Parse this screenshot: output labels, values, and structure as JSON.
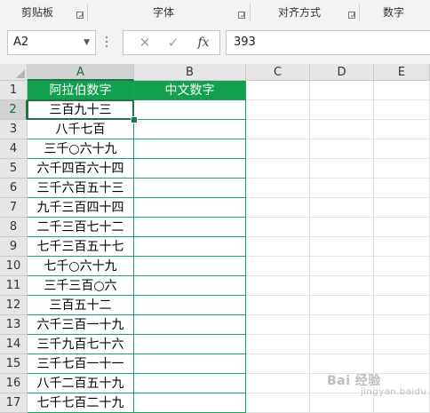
{
  "ribbon": {
    "groups": [
      "剪贴板",
      "字体",
      "对齐方式",
      "数字"
    ]
  },
  "formula_bar": {
    "name_box": "A2",
    "cancel_icon": "close-icon",
    "enter_icon": "check-icon",
    "fx_label": "fx",
    "value": "393"
  },
  "sheet": {
    "columns": [
      "A",
      "B",
      "C",
      "D",
      "E"
    ],
    "rows": [
      "1",
      "2",
      "3",
      "4",
      "5",
      "6",
      "7",
      "8",
      "9",
      "10",
      "11",
      "12",
      "13",
      "14",
      "15",
      "16",
      "17"
    ],
    "header": [
      "阿拉伯数字",
      "中文数字"
    ],
    "values": [
      "三百九十三",
      "八千七百",
      "三千○六十九",
      "六千四百六十四",
      "三千六百五十三",
      "九千三百四十四",
      "二千三百七十二",
      "七千三百五十七",
      "七千○六十九",
      "三千三百○六",
      "三百五十二",
      "六千三百一十九",
      "三千九百七十六",
      "三千七百一十一",
      "八千二百五十九",
      "七千七百二十九"
    ],
    "active_cell": "A2",
    "header_fill": "#12a04d",
    "border_color": "#21a366"
  },
  "watermark": {
    "text": "Bai 经验",
    "sub": "jingyan.baidu.com"
  }
}
